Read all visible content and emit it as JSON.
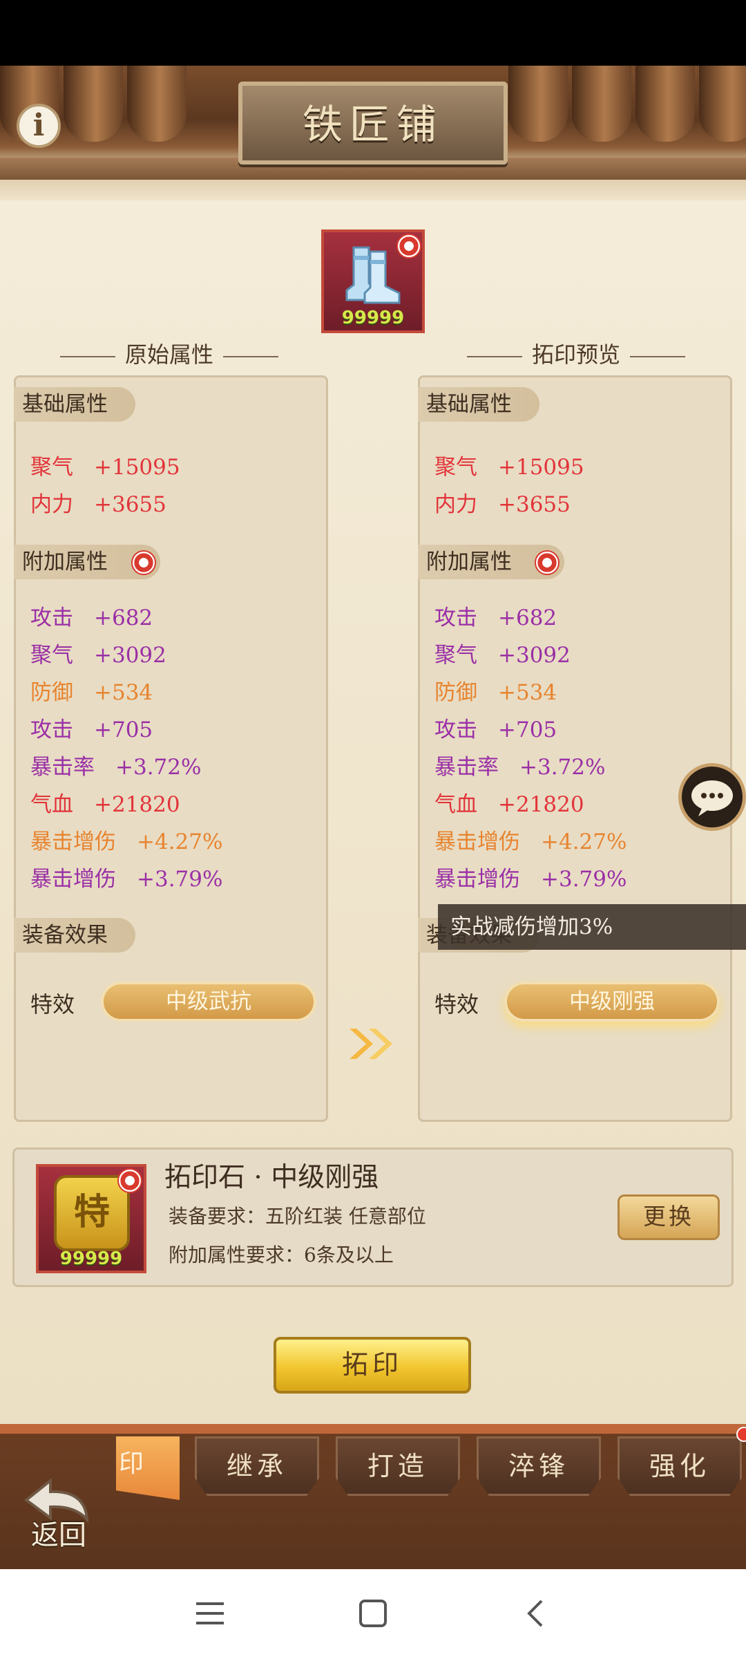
{
  "header": {
    "title": "铁匠铺",
    "info_icon": "i"
  },
  "equipment": {
    "count": "99999"
  },
  "left_panel": {
    "section_title": "原始属性",
    "base_tag": "基础属性",
    "base_stats": [
      {
        "name": "聚气",
        "value": "+15095",
        "color": "#e2343a"
      },
      {
        "name": "内力",
        "value": "+3655",
        "color": "#e2343a"
      }
    ],
    "extra_tag": "附加属性",
    "extra_stats": [
      {
        "name": "攻击",
        "value": "+682",
        "color": "#9a2fa6"
      },
      {
        "name": "聚气",
        "value": "+3092",
        "color": "#9a2fa6"
      },
      {
        "name": "防御",
        "value": "+534",
        "color": "#e7842f"
      },
      {
        "name": "攻击",
        "value": "+705",
        "color": "#9a2fa6"
      },
      {
        "name": "暴击率",
        "value": "+3.72%",
        "color": "#9a2fa6"
      },
      {
        "name": "气血",
        "value": "+21820",
        "color": "#e2343a"
      },
      {
        "name": "暴击增伤",
        "value": "+4.27%",
        "color": "#e7842f"
      },
      {
        "name": "暴击增伤",
        "value": "+3.79%",
        "color": "#9a2fa6"
      }
    ],
    "effect_tag": "装备效果",
    "effect_label": "特效",
    "effect_value": "中级武抗"
  },
  "right_panel": {
    "section_title": "拓印预览",
    "base_tag": "基础属性",
    "base_stats": [
      {
        "name": "聚气",
        "value": "+15095"
      },
      {
        "name": "内力",
        "value": "+3655"
      }
    ],
    "extra_tag": "附加属性",
    "extra_stats": [
      {
        "name": "攻击",
        "value": "+682"
      },
      {
        "name": "聚气",
        "value": "+3092"
      },
      {
        "name": "防御",
        "value": "+534"
      },
      {
        "name": "攻击",
        "value": "+705"
      },
      {
        "name": "暴击率",
        "value": "+3.72%"
      },
      {
        "name": "气血",
        "value": "+21820"
      },
      {
        "name": "暴击增伤",
        "value": "+4.27%"
      },
      {
        "name": "暴击增伤",
        "value": "+3.79%"
      }
    ],
    "effect_tag": "装备效果",
    "effect_label": "特效",
    "effect_value": "中级刚强",
    "tooltip": "实战减伤增加3%"
  },
  "stone": {
    "title": "拓印石 · 中级刚强",
    "gem_char": "特",
    "count": "99999",
    "req_equip": "装备要求：五阶红装  任意部位",
    "req_attr": "附加属性要求：6条及以上",
    "change_label": "更换"
  },
  "print_button": "拓印",
  "tabs": {
    "active": "印",
    "inherit": "继承",
    "forge": "打造",
    "temper": "淬锋",
    "strengthen": "强化"
  },
  "back_label": "返回",
  "colors": {
    "red_stat": "#e2343a",
    "purple_stat": "#9a2fa6",
    "orange_stat": "#e7842f",
    "gold_button": "#f1c62e"
  }
}
